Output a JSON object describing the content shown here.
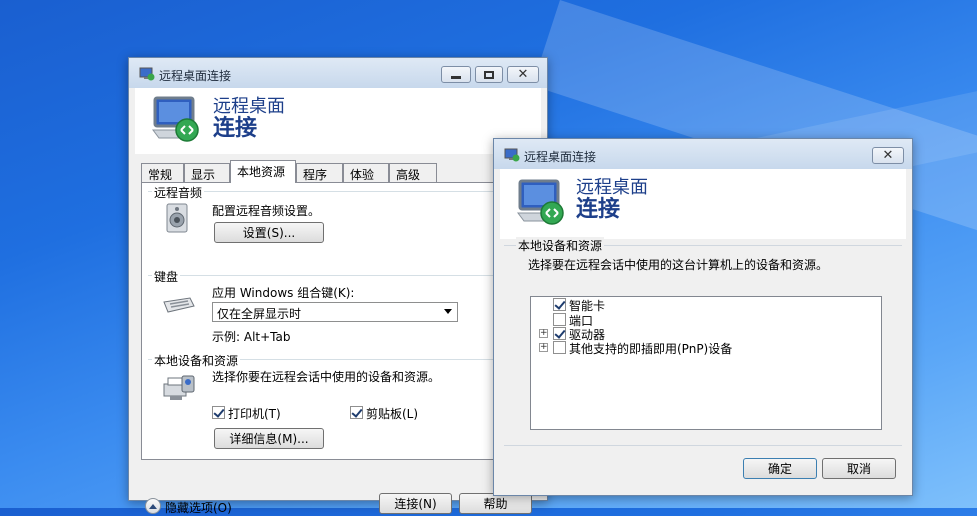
{
  "main_window": {
    "title": "远程桌面连接",
    "banner_line1": "远程桌面",
    "banner_line2": "连接",
    "tabs": [
      "常规",
      "显示",
      "本地资源",
      "程序",
      "体验",
      "高级"
    ],
    "audio": {
      "group_label": "远程音频",
      "description": "配置远程音频设置。",
      "settings_button": "设置(S)..."
    },
    "keyboard": {
      "group_label": "键盘",
      "description": "应用 Windows 组合键(K):",
      "selected": "仅在全屏显示时",
      "example": "示例: Alt+Tab"
    },
    "local_devices": {
      "group_label": "本地设备和资源",
      "description": "选择你要在远程会话中使用的设备和资源。",
      "printer_label": "打印机(T)",
      "printer_checked": true,
      "clipboard_label": "剪贴板(L)",
      "clipboard_checked": true,
      "details_button": "详细信息(M)..."
    },
    "hide_options": "隐藏选项(O)",
    "connect_button": "连接(N)",
    "help_button": "帮助"
  },
  "dialog": {
    "title": "远程桌面连接",
    "banner_line1": "远程桌面",
    "banner_line2": "连接",
    "section_label": "本地设备和资源",
    "description": "选择要在远程会话中使用的这台计算机上的设备和资源。",
    "items": [
      {
        "label": "智能卡",
        "checked": true,
        "expandable": false
      },
      {
        "label": "端口",
        "checked": false,
        "expandable": false
      },
      {
        "label": "驱动器",
        "checked": true,
        "expandable": true
      },
      {
        "label": "其他支持的即插即用(PnP)设备",
        "checked": false,
        "expandable": true
      }
    ],
    "ok_button": "确定",
    "cancel_button": "取消"
  },
  "colors": {
    "banner_text": "#1d3f8a",
    "desktop": "#1f6fe0"
  }
}
